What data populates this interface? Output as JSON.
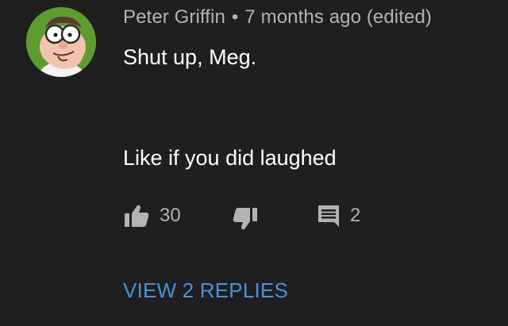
{
  "comment": {
    "author": "Peter Griffin",
    "separator": "•",
    "timestamp": "7 months ago (edited)",
    "lines": [
      "Shut up, Meg.",
      "Like if you did laughed"
    ],
    "like_count": "30",
    "reply_count": "2",
    "view_replies_label": "VIEW 2 REPLIES",
    "avatar_icon": "peter-griffin-avatar",
    "colors": {
      "background": "#1f1f1f",
      "meta_text": "#b3b3b3",
      "link": "#4d90d9"
    }
  }
}
